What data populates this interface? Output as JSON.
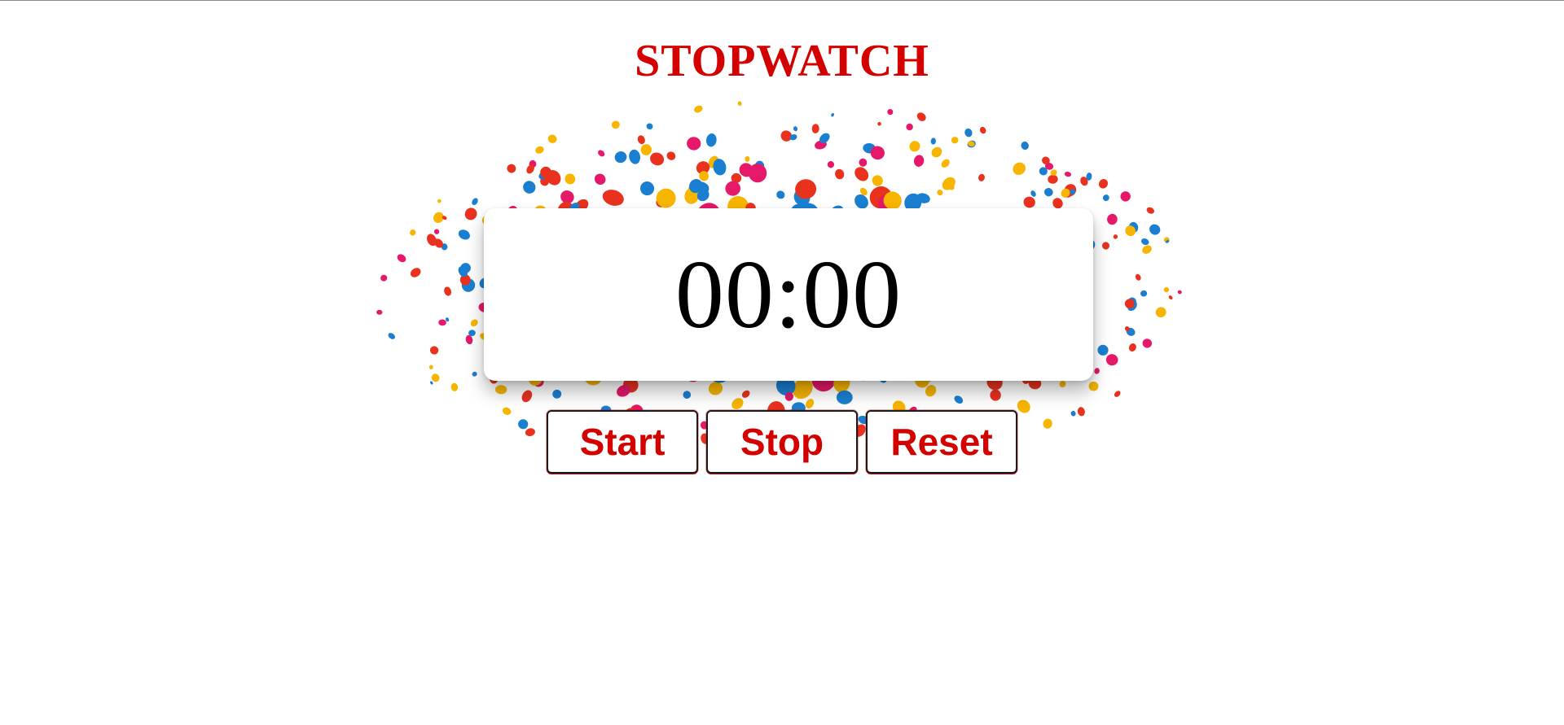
{
  "title": "STOPWATCH",
  "display": {
    "time": "00:00"
  },
  "controls": {
    "start_label": "Start",
    "stop_label": "Stop",
    "reset_label": "Reset"
  },
  "colors": {
    "accent": "#d40000",
    "confetti": [
      "#e5186a",
      "#1b7fd1",
      "#f7b500",
      "#e8321e"
    ]
  }
}
